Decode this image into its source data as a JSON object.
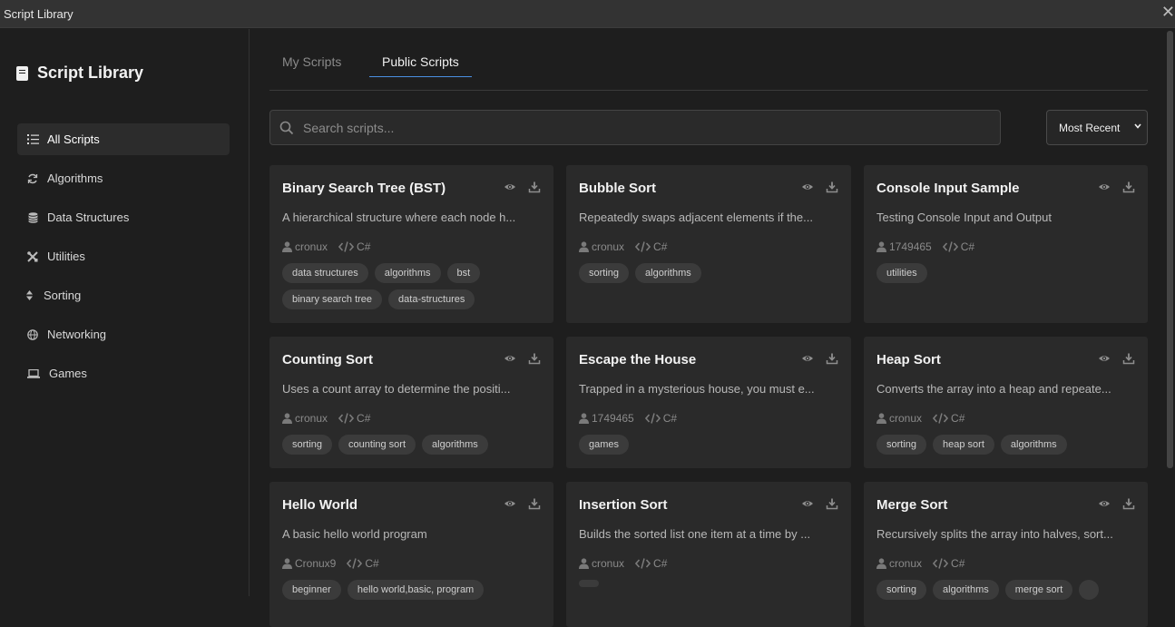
{
  "window": {
    "title": "Script Library",
    "close": "✕"
  },
  "sidebar": {
    "brand": "Script Library",
    "items": [
      {
        "label": "All Scripts",
        "icon": "list-icon",
        "active": true
      },
      {
        "label": "Algorithms",
        "icon": "refresh-icon"
      },
      {
        "label": "Data Structures",
        "icon": "database-icon"
      },
      {
        "label": "Utilities",
        "icon": "tools-icon"
      },
      {
        "label": "Sorting",
        "icon": "sort-icon"
      },
      {
        "label": "Networking",
        "icon": "globe-icon"
      },
      {
        "label": "Games",
        "icon": "laptop-icon"
      }
    ]
  },
  "tabs": {
    "my": "My Scripts",
    "public": "Public Scripts"
  },
  "search": {
    "placeholder": "Search scripts..."
  },
  "sort": {
    "selected": "Most Recent"
  },
  "cards": [
    {
      "title": "Binary Search Tree (BST)",
      "desc": "A hierarchical structure where each node h...",
      "author": "cronux",
      "lang": "C#",
      "tags": [
        "data structures",
        "algorithms",
        "bst",
        "binary search tree",
        "data-structures"
      ]
    },
    {
      "title": "Bubble Sort",
      "desc": "Repeatedly swaps adjacent elements if the...",
      "author": "cronux",
      "lang": "C#",
      "tags": [
        "sorting",
        "algorithms"
      ]
    },
    {
      "title": "Console Input Sample",
      "desc": "Testing Console Input and Output",
      "author": "1749465",
      "lang": "C#",
      "tags": [
        "utilities"
      ]
    },
    {
      "title": "Counting Sort",
      "desc": "Uses a count array to determine the positi...",
      "author": "cronux",
      "lang": "C#",
      "tags": [
        "sorting",
        "counting sort",
        "algorithms"
      ]
    },
    {
      "title": "Escape the House",
      "desc": "Trapped in a mysterious house, you must e...",
      "author": "1749465",
      "lang": "C#",
      "tags": [
        "games"
      ]
    },
    {
      "title": "Heap Sort",
      "desc": "Converts the array into a heap and repeate...",
      "author": "cronux",
      "lang": "C#",
      "tags": [
        "sorting",
        "heap sort",
        "algorithms"
      ]
    },
    {
      "title": "Hello World",
      "desc": "A basic hello world program",
      "author": "Cronux9",
      "lang": "C#",
      "tags": [
        "beginner",
        "hello world,basic, program"
      ]
    },
    {
      "title": "Insertion Sort",
      "desc": "Builds the sorted list one item at a time by ...",
      "author": "cronux",
      "lang": "C#",
      "tags": [
        ""
      ]
    },
    {
      "title": "Merge Sort",
      "desc": "Recursively splits the array into halves, sort...",
      "author": "cronux",
      "lang": "C#",
      "tags": [
        "sorting",
        "algorithms",
        "merge sort",
        ""
      ]
    }
  ]
}
